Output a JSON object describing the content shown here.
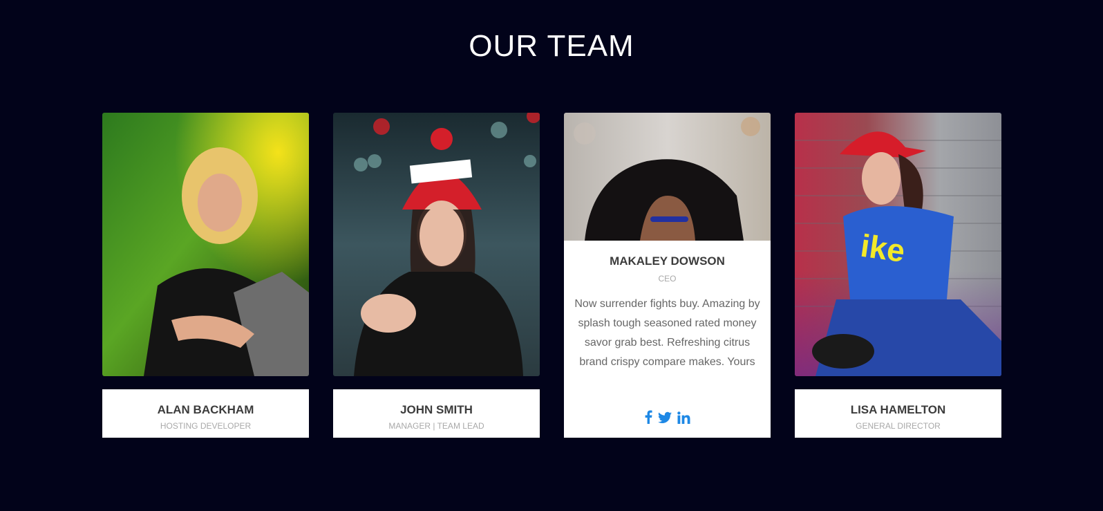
{
  "section": {
    "title": "OUR TEAM"
  },
  "members": [
    {
      "name": "ALAN BACKHAM",
      "role": "HOSTING DEVELOPER"
    },
    {
      "name": "JOHN SMITH",
      "role": "MANAGER | TEAM LEAD"
    },
    {
      "name": "MAKALEY DOWSON",
      "role": "CEO",
      "bio": "Now surrender fights buy. Amazing by splash tough seasoned rated money savor grab best. Refreshing citrus brand crispy compare makes. Yours",
      "socials": [
        "facebook-icon",
        "twitter-icon",
        "linkedin-icon"
      ]
    },
    {
      "name": "LISA HAMELTON",
      "role": "GENERAL DIRECTOR"
    }
  ],
  "colors": {
    "background": "#02031a",
    "social_accent": "#1e88e5",
    "name_text": "#3c3c3c",
    "role_text": "#a8a8a8"
  }
}
